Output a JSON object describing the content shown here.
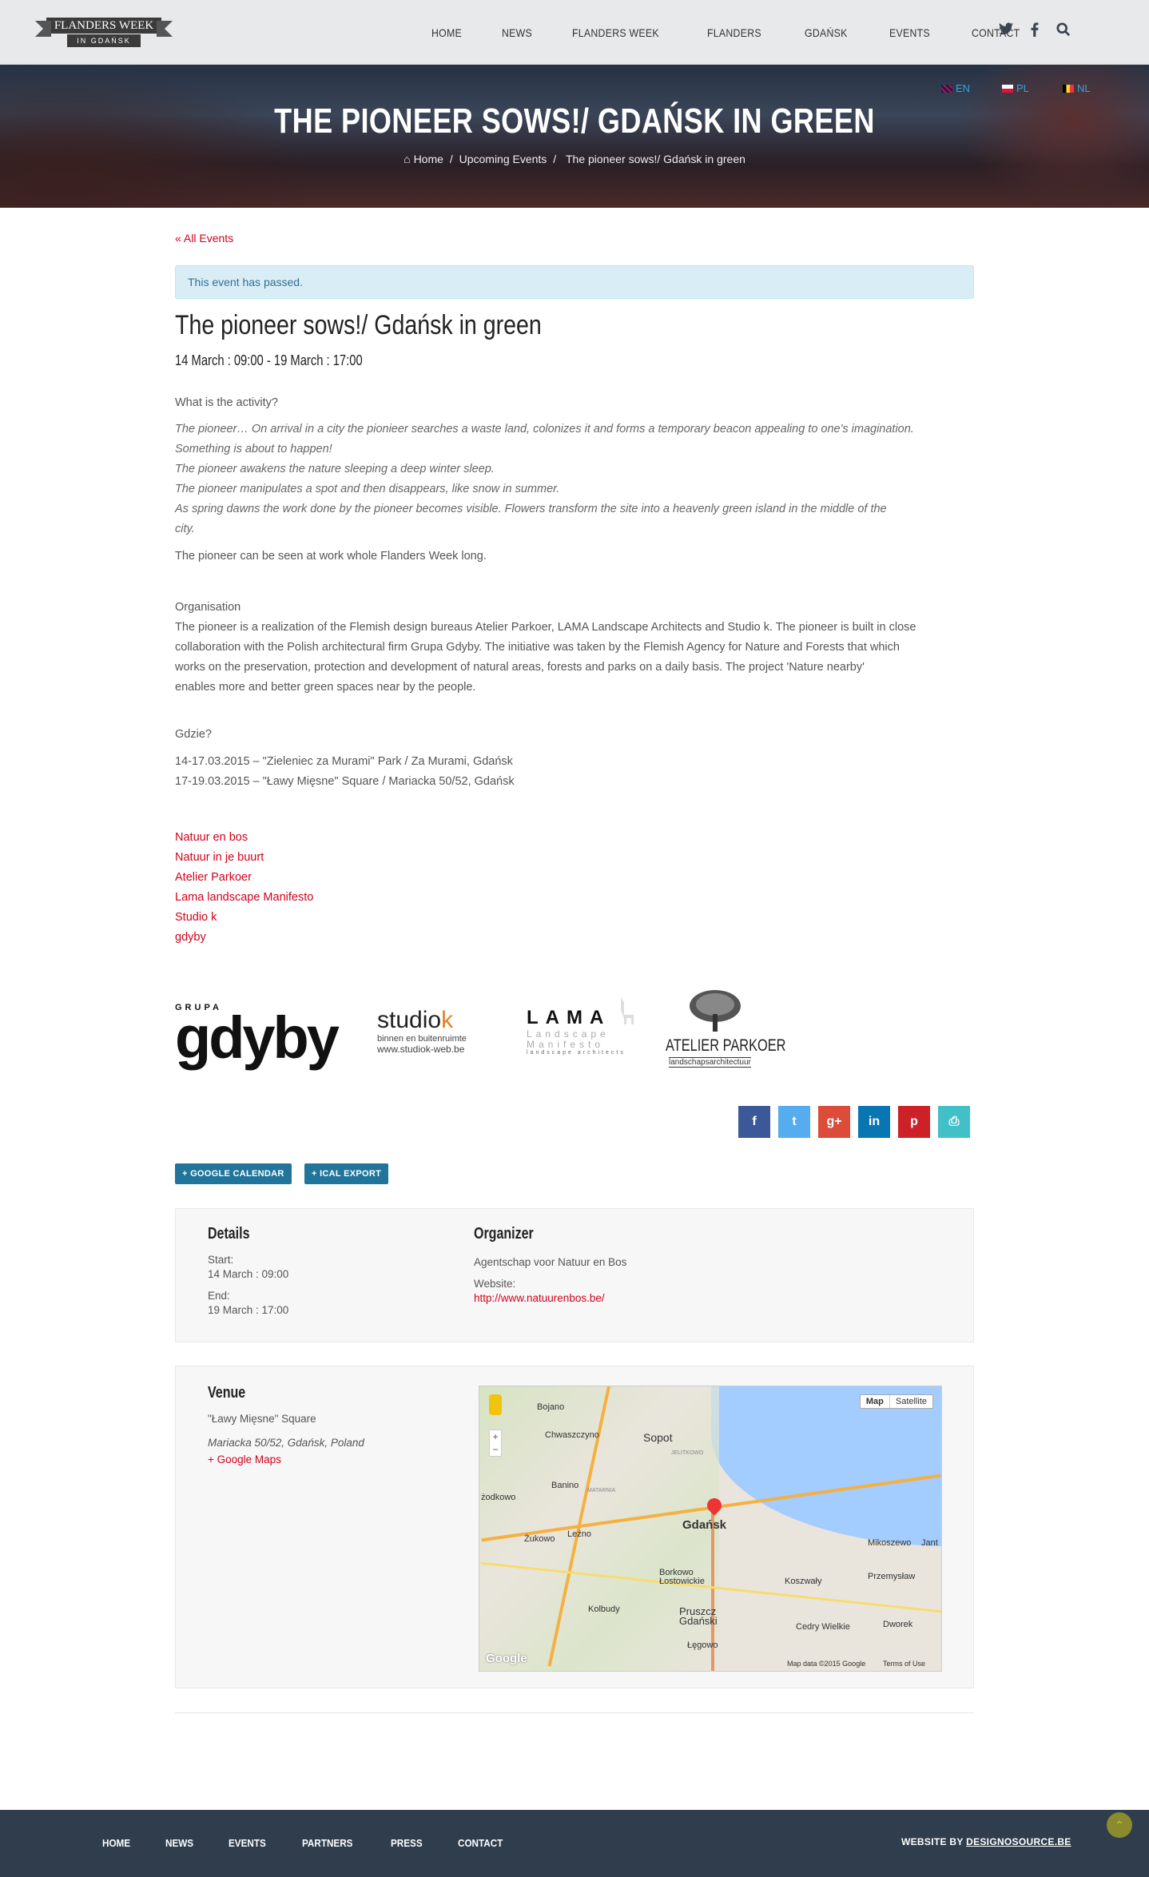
{
  "header": {
    "logo_line1": "FLANDERS WEEK",
    "logo_line2": "IN GDAŃSK",
    "nav": [
      "HOME",
      "NEWS",
      "FLANDERS WEEK",
      "FLANDERS",
      "GDAŃSK",
      "EVENTS",
      "CONTACT"
    ],
    "icons": [
      "twitter-icon",
      "facebook-icon",
      "search-icon"
    ]
  },
  "hero": {
    "languages": [
      "EN",
      "PL",
      "NL"
    ],
    "title": "THE PIONEER SOWS!/ GDAŃSK IN GREEN",
    "breadcrumb": [
      "Home",
      "Upcoming Events",
      "The pioneer sows!/ Gdańsk in green"
    ],
    "separator": "/"
  },
  "event": {
    "back_link": "« All Events",
    "alert": "This event has passed.",
    "title": "The pioneer sows!/ Gdańsk in green",
    "dates": "14 March : 09:00 - 19 March : 17:00",
    "q1": "What is the activity?",
    "italic": [
      "The pioneer… On arrival in a city the pionieer searches a waste land, colonizes it and forms a temporary beacon appealing to one's imagination.",
      "Something is about to happen!",
      "The pioneer awakens the nature sleeping a deep winter sleep.",
      "The pioneer manipulates a spot and then disappears, like snow in summer.",
      "As spring dawns the work done by the pioneer becomes visible. Flowers transform the site into a heavenly green island in the middle of the",
      "city."
    ],
    "p_week": "The pioneer can be seen at work whole Flanders Week long.",
    "org_heading": "Organisation",
    "org_lines": [
      "The pioneer is a realization of the Flemish design bureaus Atelier Parkoer, LAMA Landscape Architects and Studio k. The pioneer is built in close",
      "collaboration with the Polish architectural firm Grupa Gdyby. The initiative was taken by the Flemish Agency for Nature and Forests that which",
      "works on the preservation, protection and development of natural areas, forests and parks on a daily basis. The project 'Nature nearby'",
      "enables more and better green spaces near by the people."
    ],
    "where_heading": "Gdzie?",
    "where_lines": [
      "14-17.03.2015 – \"Zieleniec za Murami\" Park / Za Murami, Gdańsk",
      "17-19.03.2015 – \"Ławy Mięsne\" Square / Mariacka 50/52, Gdańsk"
    ],
    "links": [
      "Natuur en bos",
      "Natuur in je buurt",
      "Atelier Parkoer",
      "Lama landscape Manifesto",
      "Studio k",
      "gdyby"
    ],
    "logos": {
      "gdyby_top": "GRUPA",
      "gdyby": "gdyby",
      "studiok": "studio",
      "studiok_k": "k",
      "studiok_sub": "binnen en buitenruimte",
      "studiok_url": "www.studiok-web.be",
      "lama": "LAMA",
      "lama_l1": "Landscape",
      "lama_l2": "Manifesto",
      "lama_sub": "landscape architects",
      "parkoer": "ATELIER PARKOER",
      "parkoer_sub": "landschapsarchitectuur"
    },
    "share": [
      {
        "icon": "facebook-icon",
        "glyph": "f",
        "color": "#3b5998"
      },
      {
        "icon": "twitter-icon",
        "glyph": "t",
        "color": "#55acee"
      },
      {
        "icon": "google-plus-icon",
        "glyph": "g+",
        "color": "#dd4b39"
      },
      {
        "icon": "linkedin-icon",
        "glyph": "in",
        "color": "#0976b4"
      },
      {
        "icon": "pinterest-icon",
        "glyph": "p",
        "color": "#cc2127"
      },
      {
        "icon": "print-icon",
        "glyph": "⎙",
        "color": "#41c0c8"
      }
    ],
    "btn_gcal": "+ GOOGLE CALENDAR",
    "btn_ical": "+ ICAL EXPORT"
  },
  "details": {
    "heading": "Details",
    "start_label": "Start:",
    "start": "14 March : 09:00",
    "end_label": "End:",
    "end": "19 March : 17:00",
    "org_heading": "Organizer",
    "organizer": "Agentschap voor Natuur en Bos",
    "website_label": "Website:",
    "website": "http://www.natuurenbos.be/"
  },
  "venue": {
    "heading": "Venue",
    "name": "\"Ławy Mięsne\" Square",
    "address": "Mariacka 50/52, Gdańsk, Poland",
    "maps_link": "+ Google Maps",
    "map_buttons": [
      "Map",
      "Satellite"
    ],
    "map_labels": [
      "Bojano",
      "Chwaszczyno",
      "Sopot",
      "Banino",
      "Gdańsk",
      "Żukowo",
      "Leźno",
      "Borkowo Łostowickie",
      "Kolbudy",
      "Pruszcz Gdański",
      "Koszwały",
      "Przemysław",
      "Cedry Wielkie",
      "Dworek",
      "Mikoszewo",
      "Jant",
      "Łęgowo",
      "żodkowo",
      "JELITKOWO",
      "MATARNIA"
    ],
    "map_footer": "Map data ©2015 Google",
    "map_terms": "Terms of Use",
    "map_brand": "Google"
  },
  "footer": {
    "nav": [
      "HOME",
      "NEWS",
      "EVENTS",
      "PARTNERS",
      "PRESS",
      "CONTACT"
    ],
    "credit": "WEBSITE BY",
    "credit_link": "DESIGNOSOURCE.BE"
  }
}
